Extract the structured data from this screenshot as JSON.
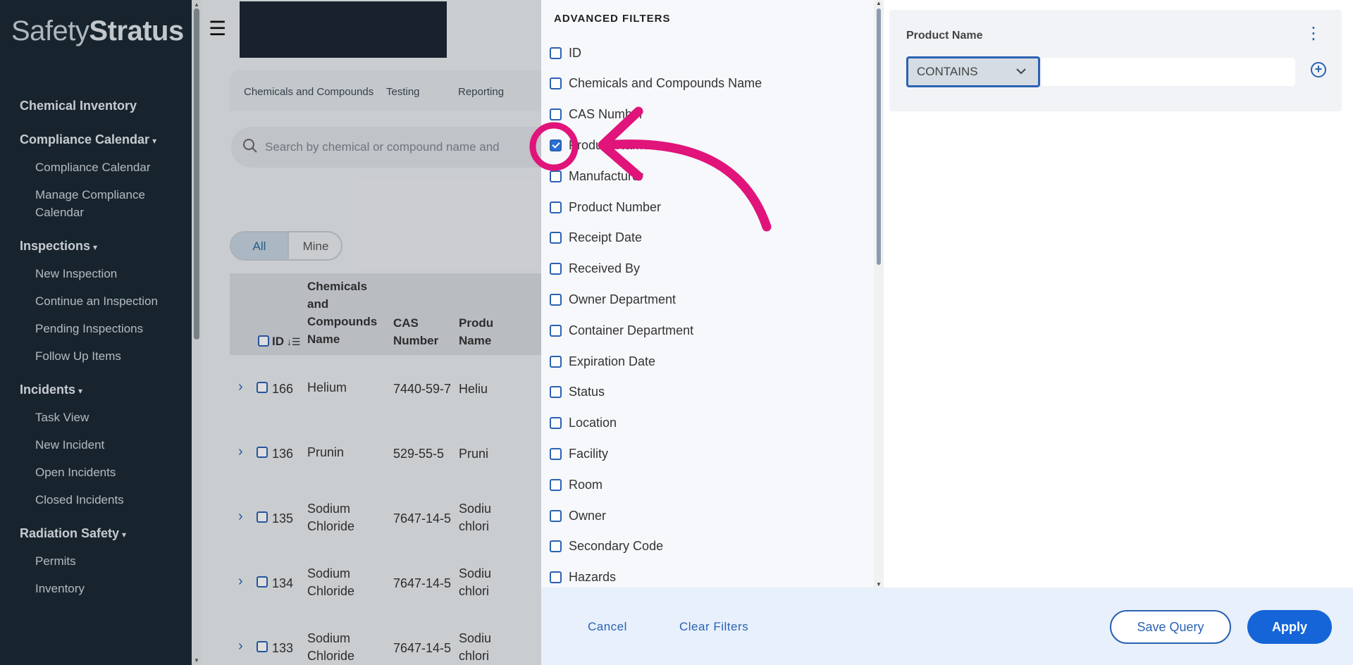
{
  "sidebar": {
    "logo_light": "Safety",
    "logo_bold": "Stratus",
    "sections": [
      {
        "label": "Chemical Inventory",
        "caret": "",
        "items": []
      },
      {
        "label": "Compliance Calendar",
        "caret": "▾",
        "items": [
          "Compliance Calendar",
          "Manage Compliance Calendar"
        ]
      },
      {
        "label": "Inspections",
        "caret": "▾",
        "items": [
          "New Inspection",
          "Continue an Inspection",
          "Pending Inspections",
          "Follow Up Items"
        ]
      },
      {
        "label": "Incidents",
        "caret": "▾",
        "items": [
          "Task View",
          "New Incident",
          "Open Incidents",
          "Closed Incidents"
        ]
      },
      {
        "label": "Radiation Safety",
        "caret": "▾",
        "items": [
          "Permits",
          "Inventory"
        ]
      }
    ]
  },
  "main": {
    "tabs": [
      "Chemicals and Compounds",
      "Testing",
      "Reporting"
    ],
    "search_placeholder": "Search by chemical or compound name and",
    "segment": {
      "all": "All",
      "mine": "Mine"
    },
    "columns": {
      "id": "ID",
      "name": "Chemicals and Compounds Name",
      "cas": "CAS Number",
      "product": "Produ Name"
    },
    "rows": [
      {
        "id": "166",
        "name": "Helium",
        "cas": "7440-59-7",
        "product": "Heliu"
      },
      {
        "id": "136",
        "name": "Prunin",
        "cas": "529-55-5",
        "product": "Pruni"
      },
      {
        "id": "135",
        "name": "Sodium Chloride",
        "cas": "7647-14-5",
        "product": "Sodiu chlori"
      },
      {
        "id": "134",
        "name": "Sodium Chloride",
        "cas": "7647-14-5",
        "product": "Sodiu chlori"
      },
      {
        "id": "133",
        "name": "Sodium Chloride",
        "cas": "7647-14-5",
        "product": "Sodiu chlori"
      }
    ]
  },
  "filters": {
    "title": "ADVANCED FILTERS",
    "items": [
      {
        "label": "ID",
        "checked": false
      },
      {
        "label": "Chemicals and Compounds Name",
        "checked": false
      },
      {
        "label": "CAS Number",
        "checked": false
      },
      {
        "label": "Product Name",
        "checked": true
      },
      {
        "label": "Manufacturer",
        "checked": false
      },
      {
        "label": "Product Number",
        "checked": false
      },
      {
        "label": "Receipt Date",
        "checked": false
      },
      {
        "label": "Received By",
        "checked": false
      },
      {
        "label": "Owner Department",
        "checked": false
      },
      {
        "label": "Container Department",
        "checked": false
      },
      {
        "label": "Expiration Date",
        "checked": false
      },
      {
        "label": "Status",
        "checked": false
      },
      {
        "label": "Location",
        "checked": false
      },
      {
        "label": "Facility",
        "checked": false
      },
      {
        "label": "Room",
        "checked": false
      },
      {
        "label": "Owner",
        "checked": false
      },
      {
        "label": "Secondary Code",
        "checked": false
      },
      {
        "label": "Hazards",
        "checked": false
      }
    ]
  },
  "query": {
    "label": "Product Name",
    "operator": "CONTAINS",
    "value": ""
  },
  "footer": {
    "cancel": "Cancel",
    "clear": "Clear Filters",
    "save": "Save Query",
    "apply": "Apply"
  },
  "colors": {
    "sidebar_bg": "#1b2a35",
    "accent": "#2b62b3",
    "annotation": "#e0147a"
  }
}
